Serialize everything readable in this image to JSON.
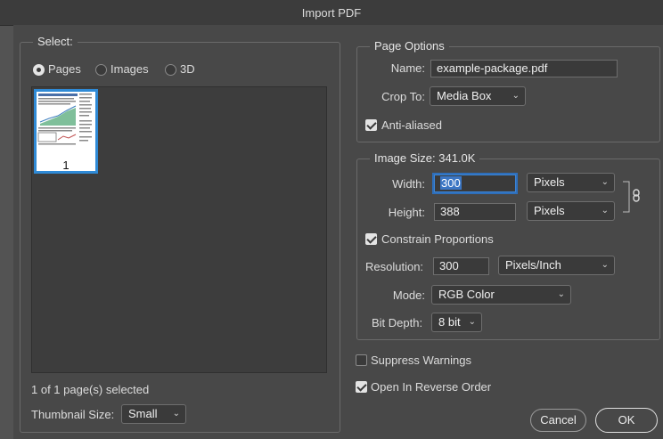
{
  "window": {
    "title": "Import PDF"
  },
  "select_group": {
    "legend": "Select:",
    "radios": [
      {
        "label": "Pages",
        "checked": true
      },
      {
        "label": "Images",
        "checked": false
      },
      {
        "label": "3D",
        "checked": false
      }
    ],
    "thumbnail": {
      "page_number": "1",
      "selected": true
    },
    "status": "1 of 1 page(s) selected",
    "thumbnail_size_label": "Thumbnail Size:",
    "thumbnail_size_value": "Small"
  },
  "page_options": {
    "legend": "Page Options",
    "name_label": "Name:",
    "name_value": "example-package.pdf",
    "crop_label": "Crop To:",
    "crop_value": "Media Box",
    "anti_aliased_label": "Anti-aliased",
    "anti_aliased_checked": true
  },
  "image_size": {
    "legend": "Image Size: 341.0K",
    "width_label": "Width:",
    "width_value": "300",
    "width_unit": "Pixels",
    "height_label": "Height:",
    "height_value": "388",
    "height_unit": "Pixels",
    "constrain_label": "Constrain Proportions",
    "constrain_checked": true,
    "resolution_label": "Resolution:",
    "resolution_value": "300",
    "resolution_unit": "Pixels/Inch",
    "mode_label": "Mode:",
    "mode_value": "RGB Color",
    "bit_depth_label": "Bit Depth:",
    "bit_depth_value": "8 bit"
  },
  "options": {
    "suppress_warnings_label": "Suppress Warnings",
    "suppress_warnings_checked": false,
    "reverse_order_label": "Open In Reverse Order",
    "reverse_order_checked": true
  },
  "buttons": {
    "cancel": "Cancel",
    "ok": "OK"
  },
  "icons": {
    "chevron": "chevron-down-icon",
    "link": "chain-link-icon"
  },
  "colors": {
    "accent": "#2f8ad6",
    "background": "#484848",
    "field": "#3a3a3a"
  }
}
